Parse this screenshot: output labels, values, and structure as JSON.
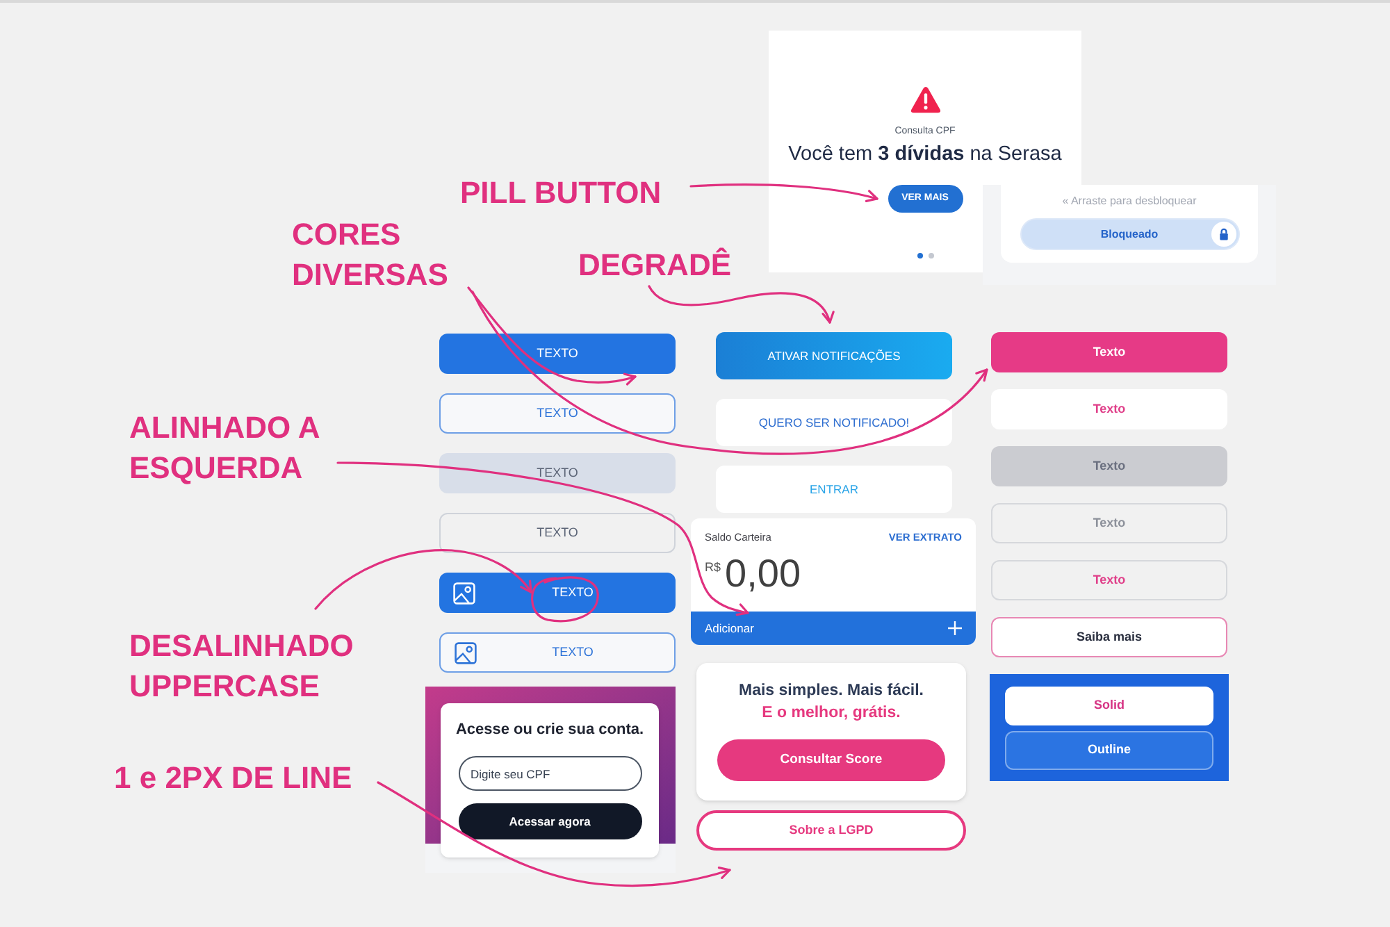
{
  "debt_card": {
    "label": "Consulta CPF",
    "headline": "Você tem **3 dívidas** na Serasa",
    "button": "VER MAIS",
    "pages": [
      {
        "selected": true
      },
      {
        "selected": false
      }
    ]
  },
  "unlock_card": {
    "hint": "« Arraste para desbloquear",
    "slider_label": "Bloqueado",
    "level": 1
  },
  "annotations": [
    {
      "text": "PILL BUTTON"
    },
    {
      "text": "CORES DIVERSAS"
    },
    {
      "text": "DEGRADÊ"
    },
    {
      "text": "ALINHADO A ESQUERDA"
    },
    {
      "text": "DESALINHADO UPPERCASE"
    },
    {
      "text": "1 e 2PX DE LINE"
    }
  ],
  "left_buttons": [
    {
      "kind": "solid",
      "icon": false,
      "label": "TEXTO"
    },
    {
      "kind": "outline",
      "icon": false,
      "label": "TEXTO"
    },
    {
      "kind": "soft",
      "icon": false,
      "label": "TEXTO"
    },
    {
      "kind": "ghost",
      "icon": false,
      "label": "TEXTO"
    },
    {
      "kind": "solid",
      "icon": true,
      "label": "TEXTO"
    },
    {
      "kind": "outline",
      "icon": true,
      "label": "TEXTO"
    }
  ],
  "login_card": {
    "title": "Acesse ou crie sua conta.",
    "cpf_field": {
      "placeholder": "Digite seu CPF"
    },
    "button": "Acessar agora"
  },
  "middle_buttons": [
    {
      "kind": "gradient",
      "label": "ATIVAR NOTIFICAÇÕES"
    },
    {
      "kind": "text_primary",
      "label": "QUERO SER NOTIFICADO!"
    },
    {
      "kind": "text_secondary",
      "label": "ENTRAR"
    }
  ],
  "wallet_card": {
    "title": "Saldo Carteira",
    "link": "VER EXTRATO",
    "currency": "R$",
    "balance": "0,00",
    "action": "Adicionar"
  },
  "score_card": {
    "line_1": "Mais simples. Mais fácil.",
    "line_2": "E o melhor, grátis.",
    "button": "Consultar Score"
  },
  "lgpd_button": {
    "label": "Sobre a LGPD"
  },
  "right_buttons": [
    {
      "kind": "solid",
      "label": "Texto"
    },
    {
      "kind": "white",
      "label": "Texto"
    },
    {
      "kind": "muted",
      "label": "Texto"
    },
    {
      "kind": "ghost",
      "label": "Texto"
    },
    {
      "kind": "ghost_accent",
      "label": "Texto"
    },
    {
      "kind": "outline",
      "label": "Saiba mais"
    }
  ],
  "blue_panel": {
    "buttons": [
      {
        "kind": "solid",
        "label": "Solid"
      },
      {
        "kind": "outline",
        "label": "Outline"
      }
    ]
  }
}
